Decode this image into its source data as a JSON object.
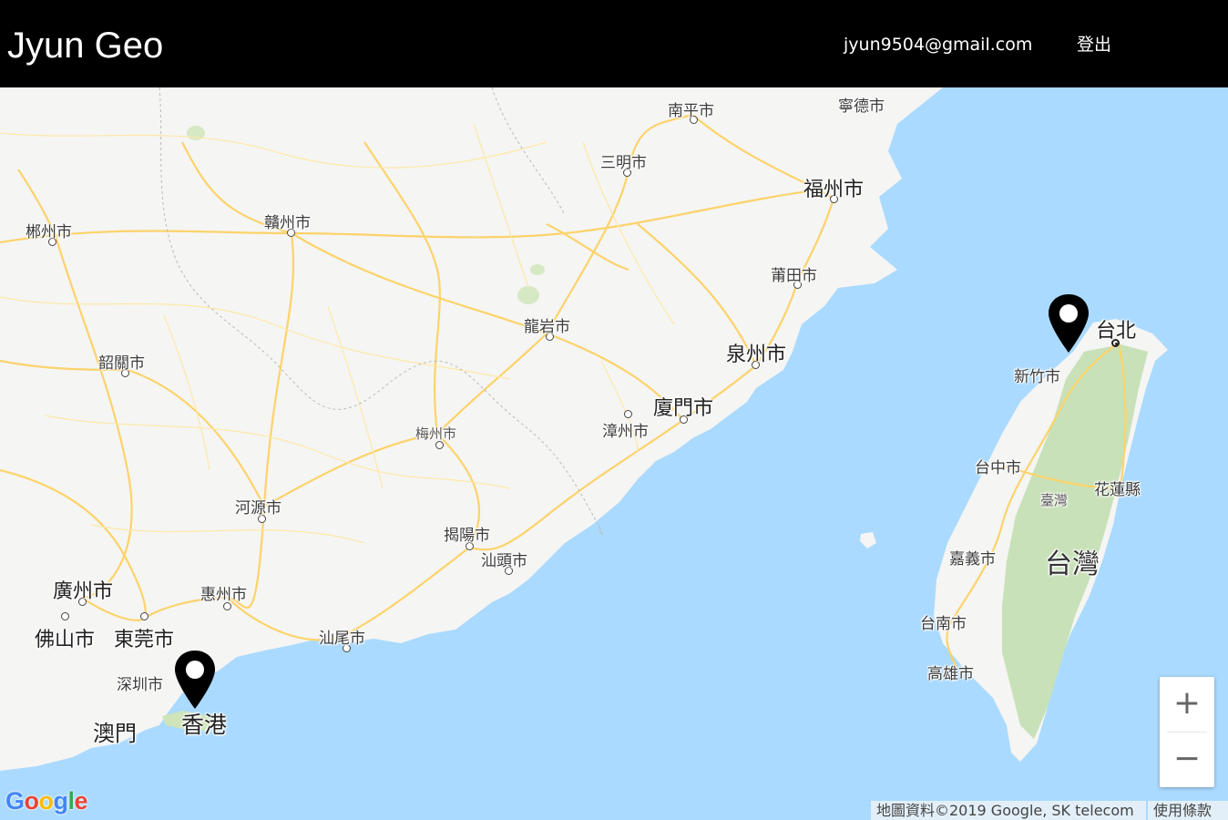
{
  "navbar": {
    "brand": "Jyun Geo",
    "user_email": "jyun9504@gmail.com",
    "logout_label": "登出"
  },
  "map": {
    "cities": [
      {
        "name": "寧德市",
        "id": "ningde"
      },
      {
        "name": "南平市",
        "id": "nanping"
      },
      {
        "name": "三明市",
        "id": "sanming"
      },
      {
        "name": "福州市",
        "id": "fuzhou"
      },
      {
        "name": "郴州市",
        "id": "chenzhou"
      },
      {
        "name": "贛州市",
        "id": "ganzhou"
      },
      {
        "name": "莆田市",
        "id": "putian"
      },
      {
        "name": "龍岩市",
        "id": "longyan"
      },
      {
        "name": "泉州市",
        "id": "quanzhou"
      },
      {
        "name": "韶關市",
        "id": "shaoguan"
      },
      {
        "name": "廈門市",
        "id": "xiamen"
      },
      {
        "name": "漳州市",
        "id": "zhangzhou"
      },
      {
        "name": "梅州市",
        "id": "meizhou"
      },
      {
        "name": "河源市",
        "id": "heyuan"
      },
      {
        "name": "揭陽市",
        "id": "jieyang"
      },
      {
        "name": "汕頭市",
        "id": "shantou"
      },
      {
        "name": "廣州市",
        "id": "guangzhou"
      },
      {
        "name": "惠州市",
        "id": "huizhou"
      },
      {
        "name": "佛山市",
        "id": "foshan"
      },
      {
        "name": "東莞市",
        "id": "dongguan"
      },
      {
        "name": "汕尾市",
        "id": "shanwei"
      },
      {
        "name": "深圳市",
        "id": "shenzhen"
      },
      {
        "name": "澳門",
        "id": "macau"
      },
      {
        "name": "香港",
        "id": "hongkong"
      },
      {
        "name": "台北",
        "id": "taipei"
      },
      {
        "name": "新竹市",
        "id": "hsinchu"
      },
      {
        "name": "台中市",
        "id": "taichung"
      },
      {
        "name": "花蓮縣",
        "id": "hualien"
      },
      {
        "name": "臺灣",
        "id": "taiwan_small"
      },
      {
        "name": "嘉義市",
        "id": "chiayi"
      },
      {
        "name": "台灣",
        "id": "taiwan_big"
      },
      {
        "name": "台南市",
        "id": "tainan"
      },
      {
        "name": "高雄市",
        "id": "kaohsiung"
      }
    ],
    "markers": [
      {
        "id": "hongkong-marker",
        "near": "香港"
      },
      {
        "id": "hsinchu-marker",
        "near": "新竹市"
      }
    ],
    "zoom_in_symbol": "+",
    "zoom_out_symbol": "−",
    "logo_text": "Google",
    "attribution": "地圖資料©2019 Google, SK telecom",
    "terms_label": "使用條款",
    "colors": {
      "water": "#aadaff",
      "land": "#f5f5f3",
      "taiwan_forest": "#c8e1b8",
      "road": "#fcd36b",
      "navbar": "#000000"
    }
  }
}
